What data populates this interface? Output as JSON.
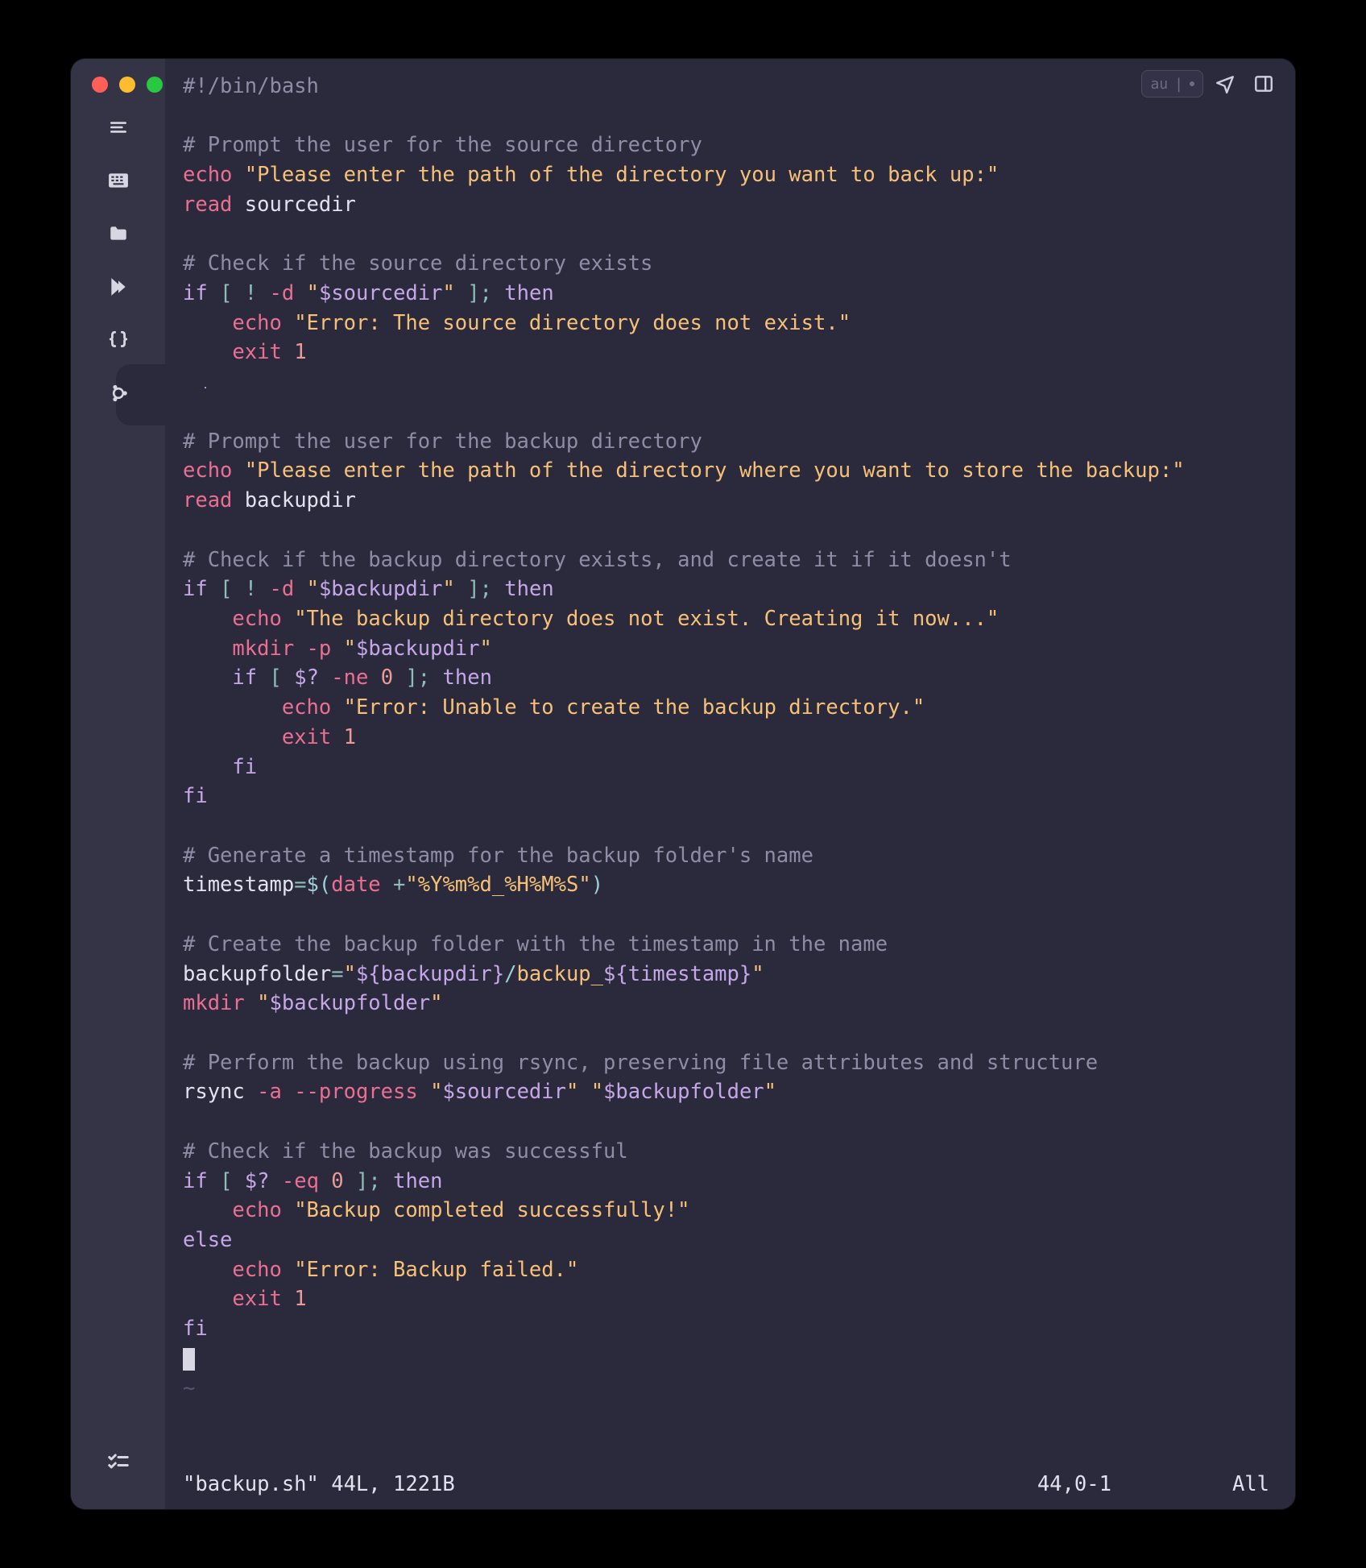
{
  "toolbar_right": {
    "pill_text": "au"
  },
  "code": {
    "shebang": "#!/bin/bash",
    "c1": "# Prompt the user for the source directory",
    "echo": "echo",
    "s1": "\"Please enter the path of the directory you want to back up:\"",
    "read": "read",
    "sourcedir": "sourcedir",
    "c2": "# Check if the source directory exists",
    "if": "if",
    "lb": "[",
    "bang": "!",
    "dflag": "-d",
    "q": "\"",
    "v_sourcedir": "$sourcedir",
    "rb_semi": "];",
    "then": "then",
    "s_err_src": "\"Error: The source directory does not exist.\"",
    "exit": "exit",
    "one": "1",
    "fi": "fi",
    "c3": "# Prompt the user for the backup directory",
    "s3": "\"Please enter the path of the directory where you want to store the backup:\"",
    "backupdir": "backupdir",
    "c4": "# Check if the backup directory exists, and create it if it doesn't",
    "v_backupdir": "$backupdir",
    "s_bk_ne": "\"The backup directory does not exist. Creating it now...\"",
    "mkdir": "mkdir",
    "pflag": "-p",
    "dq": "$?",
    "ne": "-ne",
    "zero": "0",
    "s_err_mk": "\"Error: Unable to create the backup directory.\"",
    "c5": "# Generate a timestamp for the backup folder's name",
    "timestamp_id": "timestamp",
    "eq": "=",
    "dop": "$(",
    "date": "date",
    "plus": "+",
    "fmt": "\"%Y%m%d_%H%M%S\"",
    "cp": ")",
    "c6": "# Create the backup folder with the timestamp in the name",
    "backupfolder_id": "backupfolder",
    "bf_q1": "\"",
    "bf_v1": "${backupdir}",
    "bf_slash": "/",
    "bf_lit": "backup_",
    "bf_v2": "${timestamp}",
    "v_backupfolder": "$backupfolder",
    "c7": "# Perform the backup using rsync, preserving file attributes and structure",
    "rsync": "rsync",
    "aflag": "-a",
    "progress": "--progress",
    "c8": "# Check if the backup was successful",
    "eqop": "-eq",
    "s_ok": "\"Backup completed successfully!\"",
    "else": "else",
    "s_fail": "\"Error: Backup failed.\"",
    "tilde": "~"
  },
  "status": {
    "left": "\"backup.sh\" 44L, 1221B",
    "mid": "44,0-1",
    "right": "All"
  }
}
